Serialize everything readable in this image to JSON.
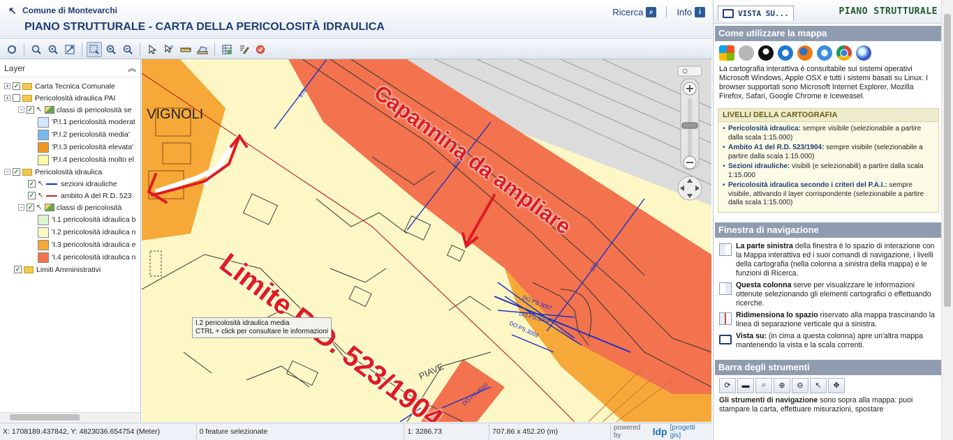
{
  "header": {
    "brand": "Comune di Montevarchi",
    "title": "PIANO STRUTTURALE - CARTA DELLA PERICOLOSITÀ IDRAULICA",
    "ricerca": "Ricerca",
    "info": "Info"
  },
  "toolbar": {
    "tools": [
      "refresh-icon",
      "zoom-full-icon",
      "zoom-previous-icon",
      "zoom-extent-icon",
      "zoom-box-icon",
      "zoom-in-icon",
      "zoom-out-icon",
      "select-icon",
      "pan-icon",
      "measure-icon",
      "print-icon",
      "table-icon",
      "edit-icon",
      "reset-icon"
    ]
  },
  "layers": {
    "heading": "Layer",
    "items": [
      {
        "label": "Carta Tecnica Comunale"
      },
      {
        "label": "Pericolosità idraulica PAI"
      },
      {
        "label": "classi di pericolosità se"
      },
      {
        "label": "'P.I.1 pericolosità moderat",
        "color": "#cfe8ff"
      },
      {
        "label": "'P.I.2 pericolosità media'",
        "color": "#7ab8f0"
      },
      {
        "label": "'P.I.3 pericolosità elevata'",
        "color": "#f0961e"
      },
      {
        "label": "'P.I.4 pericolosità molto el",
        "color": "#fff8a8"
      },
      {
        "label": "Pericolosità idraulica"
      },
      {
        "label": "sezioni idrauliche",
        "color": "#1c2fc6"
      },
      {
        "label": "ambito A del R.D. 523",
        "color": "#c0282a"
      },
      {
        "label": "classi di pericolosità"
      },
      {
        "label": "'I.1 pericolosità idraulica b",
        "color": "#d8f5cf"
      },
      {
        "label": "'I.2 pericolosità idraulica n",
        "color": "#fdf7c6"
      },
      {
        "label": "'I.3 pericolosità idraulica e",
        "color": "#f6a938"
      },
      {
        "label": "'I.4 pericolosità idraulica n",
        "color": "#f2734e"
      },
      {
        "label": "Limiti Amministrativi"
      }
    ]
  },
  "map": {
    "street_vignoli": "I VIGNOLI",
    "street_piave": "PIAVE",
    "annotation_limite": "Limite R.D. 523/1904",
    "annotation_capannina": "Capannina da ampliare",
    "section_labels": [
      "878",
      "877",
      "876",
      "DO.PS.3007",
      "DO.PS.3008",
      "DO.PS.3009",
      "DO.PS.3010"
    ],
    "tooltip_line1": "I.2 pericolosità idraulica media",
    "tooltip_line2": "CTRL + click per consultare le informazioni"
  },
  "status": {
    "coords": "X: 1708189.437842, Y: 4823036.654754 (Meter)",
    "features": "0 feature selezionate",
    "scale": "1: 3286.73",
    "size": "707.86 x 452.20 (m)",
    "powered": "powered by",
    "ldp": "ldp",
    "progetti": "[progetti gis]"
  },
  "right": {
    "vista_label": "VISTA SU...",
    "ps_title": "PIANO STRUTTURALE",
    "how_title": "Come utilizzare la mappa",
    "how_text": "La cartografia interattiva è consultabile sui sistemi operativi Microsoft Windows, Apple OSX e tutti i sistemi basati su Linux. I browser supportati sono Microsoft Internet Explorer, Mozilla Firefox, Safari, Google Chrome e Iceweasel.",
    "livelli_title": "LIVELLI DELLA CARTOGRAFIA",
    "livelli": [
      {
        "k": "Pericolosità idraulica:",
        "v": " sempre visibile (selezionabile a partire dalla scala 1:15.000)"
      },
      {
        "k": "Ambito A1 del R.D. 523/1904:",
        "v": " sempre visibile (selezionabile a partire dalla scala 1:15.000)"
      },
      {
        "k": "Sezioni idrauliche:",
        "v": " visibili (e selezionabili) a partire dalla scala 1:15.000"
      },
      {
        "k": "Pericolosità idraulica secondo i criteri del P.A.I.:",
        "v": " sempre visibile, attivando il layer corrispondente (selezionabile a partire dalla scala 1:15.000)"
      }
    ],
    "nav_title": "Finestra di navigazione",
    "nav_items": [
      {
        "b": "La parte sinistra",
        "t": " della finestra è lo spazio di interazione con la Mappa interattiva ed i suoi comandi di navigazione, i livelli della cartografia (nella colonna a sinistra della mappa) e le funzioni di Ricerca."
      },
      {
        "b": "Questa colonna",
        "t": " serve per visualizzare le informazioni ottenute selezionando gli elementi cartografici o effettuando ricerche."
      },
      {
        "b": "Ridimensiona lo spazio",
        "t": " riservato alla mappa trascinando la linea di separazione verticale qui a sinistra."
      },
      {
        "b": "Vista su:",
        "t": " (in cima a questa colonna) apre un'altra mappa mantenendo la vista e la scala correnti."
      }
    ],
    "bar_title": "Barra degli strumenti",
    "bar_text_b": "Gli strumenti di navigazione",
    "bar_text": " sono sopra alla mappa: puoi stampare la carta, effettuare misurazioni, spostare"
  }
}
